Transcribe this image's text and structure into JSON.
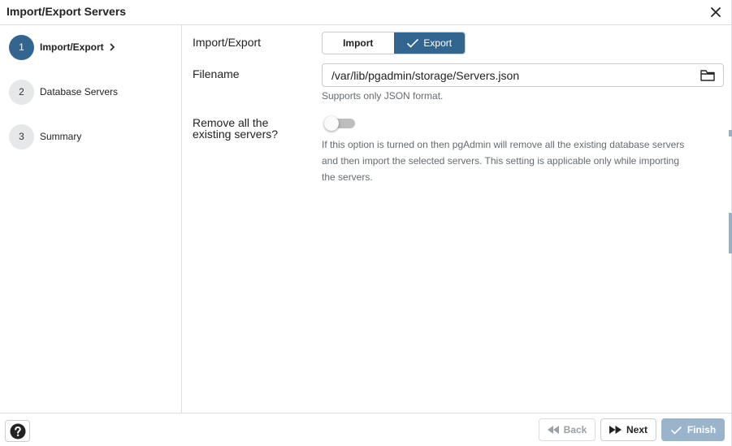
{
  "dialog": {
    "title": "Import/Export Servers"
  },
  "steps": [
    {
      "number": "1",
      "label": "Import/Export"
    },
    {
      "number": "2",
      "label": "Database Servers"
    },
    {
      "number": "3",
      "label": "Summary"
    }
  ],
  "form": {
    "import_export": {
      "label": "Import/Export",
      "options": [
        "Import",
        "Export"
      ],
      "selected": "Export"
    },
    "filename": {
      "label": "Filename",
      "value": "/var/lib/pgadmin/storage/Servers.json",
      "help": "Supports only JSON format."
    },
    "remove_servers": {
      "label_line1": "Remove all the",
      "label_line2": "existing servers?",
      "enabled": false,
      "help_line1": "If this option is turned on then pgAdmin will remove all the existing database servers",
      "help_line2": "and then import the selected servers. This setting is applicable only while importing",
      "help_line3": "the servers."
    }
  },
  "footer": {
    "back_label": "Back",
    "next_label": "Next",
    "finish_label": "Finish"
  },
  "colors": {
    "accent": "#326690",
    "finish_disabled": "#9ab4cc"
  }
}
